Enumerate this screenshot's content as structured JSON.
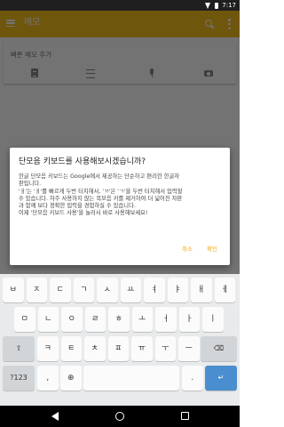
{
  "status_bar": {
    "time": "7:17"
  },
  "app_bar": {
    "title": "메모"
  },
  "note": {
    "placeholder": "빠른 메모 추가"
  },
  "dialog": {
    "title": "단모음 키보드를 사용해보시겠습니까?",
    "body": [
      "한글 단모음 키보드는 Google에서 제공하는 단순하고 편리한 한글자",
      "판입니다.",
      "'ㅐ'는 'ㅐ'를 빠르게 두번 터치해서, 'ㄲ'은 'ㄱ'을 두번 터치해서 입력할",
      "수 있습니다. 자주 사용하지 않는 복모음 키를 제거하여 더 넓어진 자판",
      "과 함께 보다 정확한 입력을 경험하실 수 있습니다.",
      "이제 '단모음 키보드 사용'을 눌러서 바로 사용해보세요!"
    ],
    "cancel_label": "취소",
    "ok_label": "확인"
  },
  "keyboard": {
    "row1": [
      "ㅂ",
      "ㅈ",
      "ㄷ",
      "ㄱ",
      "ㅅ",
      "ㅛ",
      "ㅕ",
      "ㅑ",
      "ㅐ",
      "ㅔ"
    ],
    "row2": [
      "ㅁ",
      "ㄴ",
      "ㅇ",
      "ㄹ",
      "ㅎ",
      "ㅗ",
      "ㅓ",
      "ㅏ",
      "ㅣ"
    ],
    "row3": [
      "ㅋ",
      "ㅌ",
      "ㅊ",
      "ㅍ",
      "ㅠ",
      "ㅜ",
      "ㅡ"
    ],
    "shift": "⇧",
    "backspace": "⌫",
    "symbols": "?123",
    "comma": ",",
    "globe": "⊕",
    "space": "",
    "period": ".",
    "enter": "↵"
  }
}
